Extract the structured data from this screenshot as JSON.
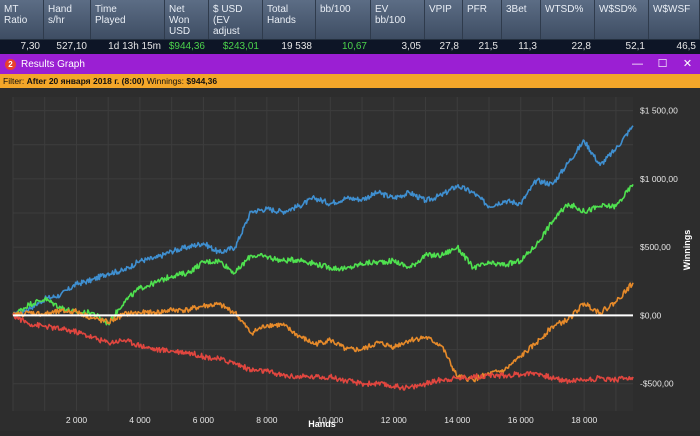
{
  "stats": {
    "headers": [
      "MT\nRatio",
      "Hand\ns/hr",
      "Time\nPlayed",
      "Net\nWon\nUSD",
      "$ USD\n(EV\nadjust",
      "Total\nHands",
      "bb/100",
      "EV\nbb/100",
      "VPIP",
      "PFR",
      "3Bet",
      "WTSD%",
      "W$SD%",
      "W$WSF"
    ],
    "values": [
      "7,30",
      "527,10",
      "1d 13h 15m",
      "$944,36",
      "$243,01",
      "19 538",
      "10,67",
      "3,05",
      "27,8",
      "21,5",
      "11,3",
      "22,8",
      "52,1",
      "46,5"
    ],
    "green_cols": [
      3,
      4,
      6
    ]
  },
  "window": {
    "icon_label": "2",
    "title": "Results Graph",
    "minimize": "—",
    "maximize": "☐",
    "close": "✕"
  },
  "filter": {
    "prefix": "Filter: ",
    "after": "After 20 января 2018 г. (8:00)",
    "winnings_label": "  Winnings: ",
    "winnings_value": "$944,36"
  },
  "colors": {
    "blue": "#3f8fd0",
    "green": "#4fe14f",
    "orange": "#e68a2a",
    "red": "#e0463f",
    "zero_line": "#ffffff",
    "title_bar": "#9b1fd3",
    "filter_bar": "#f3a629"
  },
  "chart_data": {
    "type": "line",
    "xlabel": "Hands",
    "ylabel": "Winnings",
    "xlim": [
      0,
      19538
    ],
    "ylim": [
      -700,
      1600
    ],
    "x_ticks": [
      2000,
      4000,
      6000,
      8000,
      10000,
      12000,
      14000,
      16000,
      18000
    ],
    "x_tick_labels": [
      "2 000",
      "4 000",
      "6 000",
      "8 000",
      "10 000",
      "12 000",
      "14 000",
      "16 000",
      "18 000"
    ],
    "y_ticks": [
      1500,
      1000,
      500,
      0,
      -500
    ],
    "y_tick_labels": [
      "$1 500,00",
      "$1 000,00",
      "$500,00",
      "$0,00",
      "-$500,00"
    ],
    "grid": true,
    "x": [
      0,
      500,
      1000,
      1500,
      2000,
      2500,
      3000,
      3500,
      4000,
      4500,
      5000,
      5500,
      6000,
      6500,
      7000,
      7500,
      8000,
      8500,
      9000,
      9500,
      10000,
      10500,
      11000,
      11500,
      12000,
      12500,
      13000,
      13500,
      14000,
      14500,
      15000,
      15500,
      16000,
      16500,
      17000,
      17500,
      18000,
      18500,
      19000,
      19538
    ],
    "series": [
      {
        "color_key": "blue",
        "values": [
          0,
          50,
          120,
          150,
          230,
          260,
          310,
          330,
          400,
          420,
          470,
          500,
          530,
          460,
          500,
          760,
          780,
          760,
          800,
          860,
          820,
          860,
          850,
          900,
          860,
          900,
          840,
          880,
          950,
          900,
          800,
          840,
          820,
          990,
          960,
          1120,
          1280,
          1100,
          1220,
          1390
        ]
      },
      {
        "color_key": "green",
        "values": [
          0,
          80,
          120,
          60,
          20,
          20,
          -60,
          100,
          200,
          240,
          290,
          310,
          390,
          400,
          310,
          440,
          430,
          400,
          410,
          380,
          350,
          340,
          380,
          390,
          400,
          350,
          440,
          440,
          500,
          350,
          380,
          370,
          400,
          520,
          690,
          820,
          760,
          800,
          800,
          960
        ]
      },
      {
        "color_key": "orange",
        "values": [
          0,
          20,
          10,
          30,
          30,
          -20,
          -50,
          10,
          20,
          20,
          40,
          40,
          70,
          80,
          20,
          -130,
          -70,
          -70,
          -150,
          -210,
          -180,
          -250,
          -250,
          -200,
          -230,
          -180,
          -160,
          -220,
          -450,
          -470,
          -430,
          -400,
          -300,
          -200,
          -80,
          -30,
          90,
          20,
          100,
          240
        ]
      },
      {
        "color_key": "red",
        "values": [
          0,
          -60,
          -80,
          -100,
          -120,
          -160,
          -200,
          -180,
          -220,
          -250,
          -260,
          -270,
          -300,
          -320,
          -350,
          -400,
          -410,
          -440,
          -450,
          -450,
          -450,
          -480,
          -500,
          -500,
          -520,
          -530,
          -500,
          -470,
          -460,
          -450,
          -440,
          -440,
          -430,
          -420,
          -460,
          -480,
          -470,
          -460,
          -470,
          -450
        ]
      }
    ]
  }
}
